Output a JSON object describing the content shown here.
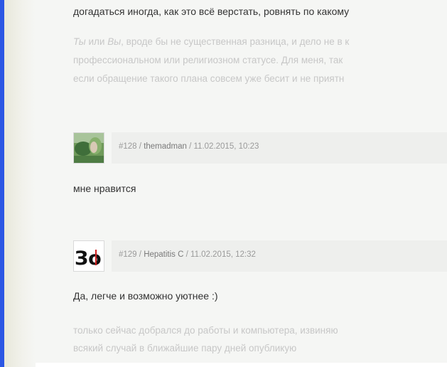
{
  "top_text": "догадаться иногда, как это всё верстать, ровнять по какому",
  "faded_block_1": {
    "line1_em": "Ты",
    "line1_mid": " или ",
    "line1_em2": "Вы",
    "line1_rest": ", вроде бы не существенная разница, и дело не в к",
    "line2": "профессиональном или религиозном статусе. Для меня, так",
    "line3": "если обращение такого плана совсем уже бесит и не приятн"
  },
  "comments": [
    {
      "number": "#128",
      "author": "themadman",
      "date": "11.02.2015, 10:23",
      "avatar_icon": "photo-avatar",
      "text": "мне нравится"
    },
    {
      "number": "#129",
      "author": "Hepatitis C",
      "date": "11.02.2015, 12:32",
      "avatar_icon": "logo-avatar",
      "avatar_text": "Зо",
      "text": "Да, легче и возможно уютнее :)"
    }
  ],
  "faded_block_2": {
    "line1": "только сейчас добрался до работы и компьютера, извиняю",
    "line2": "всякий случай в ближайшие пару дней опубликую"
  },
  "colors": {
    "accent_rail": "#2c57e4",
    "content_bg": "#f5f6f4",
    "text": "#333333",
    "faded_text": "#c7c7c7"
  }
}
